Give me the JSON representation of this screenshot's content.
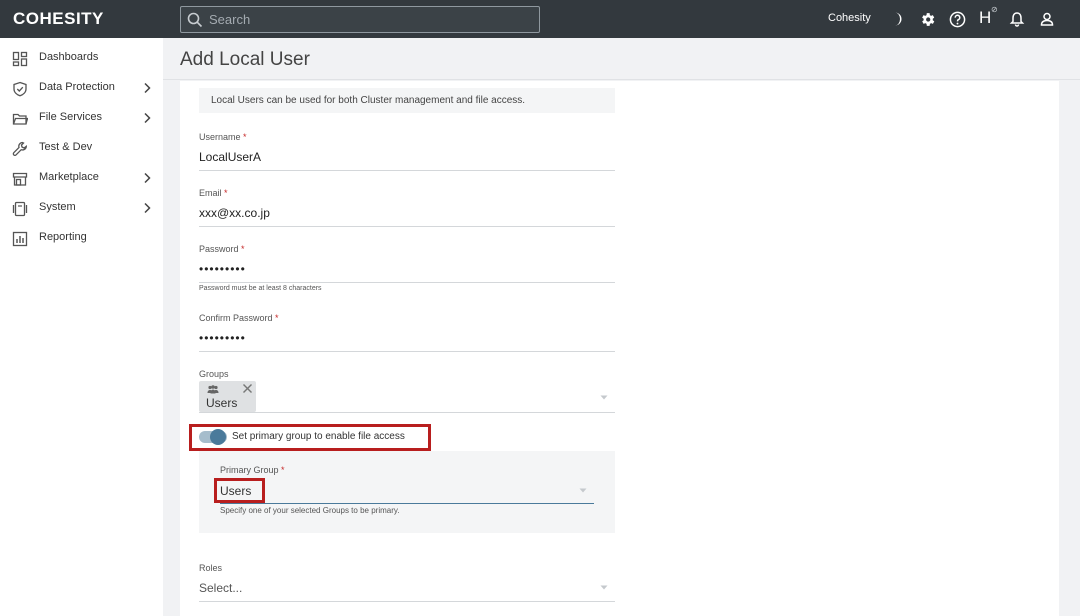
{
  "topbar": {
    "logo": "COHESITY",
    "search_placeholder": "Search",
    "cluster_name": "Cohesity",
    "helios_letter": "H",
    "icons": [
      "moon-icon",
      "gear-icon",
      "help-icon",
      "helios-icon",
      "bell-icon",
      "user-icon"
    ]
  },
  "sidebar": {
    "items": [
      {
        "label": "Dashboards",
        "icon": "dashboard-icon",
        "has_children": false
      },
      {
        "label": "Data Protection",
        "icon": "shield-icon",
        "has_children": true
      },
      {
        "label": "File Services",
        "icon": "folder-icon",
        "has_children": true
      },
      {
        "label": "Test & Dev",
        "icon": "wrench-icon",
        "has_children": false
      },
      {
        "label": "Marketplace",
        "icon": "store-icon",
        "has_children": true
      },
      {
        "label": "System",
        "icon": "system-icon",
        "has_children": true
      },
      {
        "label": "Reporting",
        "icon": "chart-icon",
        "has_children": false
      }
    ]
  },
  "page": {
    "title": "Add Local User",
    "info": "Local Users can be used for both Cluster management and file access."
  },
  "form": {
    "username": {
      "label": "Username",
      "required": "*",
      "value": "LocalUserA"
    },
    "email": {
      "label": "Email",
      "required": "*",
      "value": "xxx@xx.co.jp"
    },
    "password": {
      "label": "Password",
      "required": "*",
      "value": "•••••••••",
      "hint": "Password must be at least 8 characters"
    },
    "confirm_password": {
      "label": "Confirm Password",
      "required": "*",
      "value": "•••••••••"
    },
    "groups": {
      "label": "Groups",
      "chips": [
        {
          "label": "Users"
        }
      ]
    },
    "primary_toggle": {
      "label": "Set primary group to enable file access",
      "on": true
    },
    "primary_group": {
      "label": "Primary Group",
      "required": "*",
      "value": "Users",
      "hint": "Specify one of your selected Groups to be primary."
    },
    "roles": {
      "label": "Roles",
      "value": "Select..."
    }
  },
  "colors": {
    "topbar": "#33393e",
    "accent": "#4a7a9b",
    "highlight": "#b81e1e",
    "required": "#c62828"
  }
}
